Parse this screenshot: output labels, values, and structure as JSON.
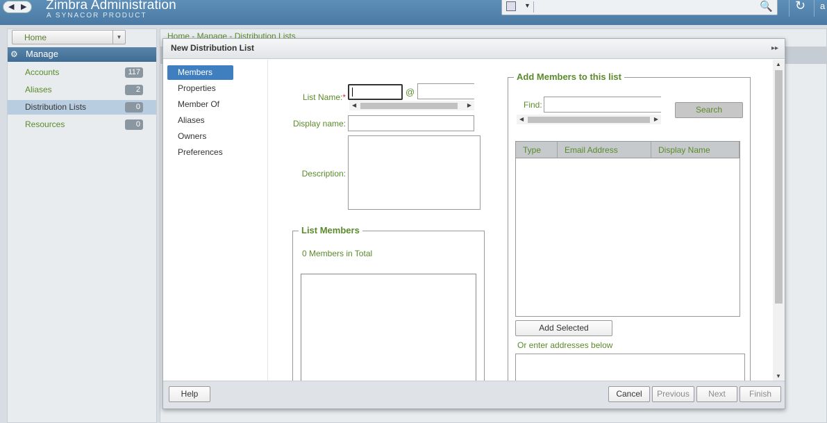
{
  "header": {
    "brand": "Zimbra Administration",
    "brand_sub": "A SYNACOR PRODUCT",
    "user_initial": "a",
    "icons": [
      "back-arrow-icon",
      "forward-arrow-icon",
      "search-type-icon",
      "magnifier-icon",
      "refresh-icon"
    ]
  },
  "left": {
    "home_label": "Home",
    "manage_label": "Manage",
    "items": [
      {
        "label": "Accounts",
        "count": "117"
      },
      {
        "label": "Aliases",
        "count": "2"
      },
      {
        "label": "Distribution Lists",
        "count": "0"
      },
      {
        "label": "Resources",
        "count": "0"
      }
    ]
  },
  "background": {
    "breadcrumb": "Home - Manage - Distribution Lists"
  },
  "dialog": {
    "title": "New Distribution List",
    "nav": [
      "Members",
      "Properties",
      "Member Of",
      "Aliases",
      "Owners",
      "Preferences"
    ],
    "form": {
      "list_name_label": "List Name:",
      "required_mark": "*",
      "at_sign": "@",
      "list_name_value": "",
      "domain_value": "",
      "display_name_label": "Display name:",
      "display_name_value": "",
      "description_label": "Description:",
      "description_value": ""
    },
    "list_members": {
      "legend": "List Members",
      "total_text": "0 Members in Total"
    },
    "add_members": {
      "legend": "Add Members to this list",
      "find_label": "Find:",
      "find_value": "",
      "search_button": "Search",
      "columns": [
        "Type",
        "Email Address",
        "Display Name"
      ],
      "add_selected_button": "Add Selected",
      "or_enter_text": "Or enter addresses below"
    },
    "footer": {
      "help": "Help",
      "cancel": "Cancel",
      "previous": "Previous",
      "next": "Next",
      "finish": "Finish"
    }
  }
}
